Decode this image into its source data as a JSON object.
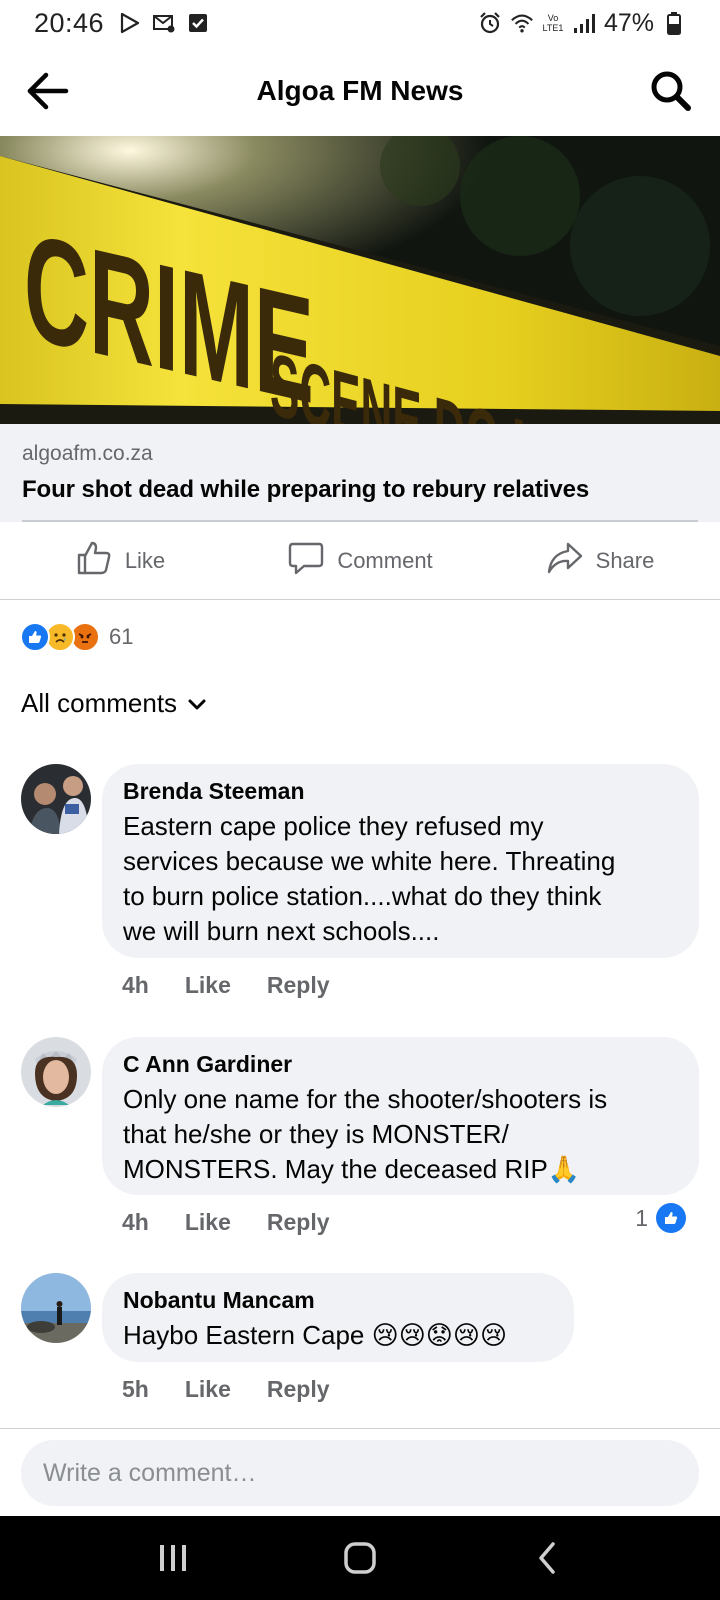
{
  "status_bar": {
    "time": "20:46",
    "carrier_label": "Vo LTE1",
    "battery_percent": "47%",
    "icons": [
      "play-store-icon",
      "mail-settings-icon",
      "checkbox-icon",
      "alarm-icon",
      "wifi-icon",
      "signal-icon",
      "battery-icon"
    ]
  },
  "header": {
    "title": "Algoa FM News",
    "icons": [
      "back-arrow-icon",
      "search-icon"
    ]
  },
  "post": {
    "image_text": "CRIME SCENE DO NOT CROSS",
    "link_domain": "algoafm.co.za",
    "link_title": "Four shot dead while preparing to rebury relatives"
  },
  "actions": {
    "like": "Like",
    "comment": "Comment",
    "share": "Share"
  },
  "reactions": {
    "count": "61",
    "types": [
      "like",
      "sad",
      "angry"
    ]
  },
  "comments_filter": {
    "label": "All comments"
  },
  "comments": [
    {
      "name": "Brenda Steeman",
      "lines": [
        "Eastern cape police they refused my",
        "services because we white here. Threating",
        "to burn police station....what do they think",
        "we will burn next schools...."
      ],
      "time": "4h",
      "like_label": "Like",
      "reply_label": "Reply"
    },
    {
      "name": "C Ann Gardiner",
      "lines": [
        "Only one name for the shooter/shooters is",
        "that he/she or they is MONSTER/",
        "MONSTERS. May the deceased RIP🙏"
      ],
      "time": "4h",
      "like_label": "Like",
      "reply_label": "Reply",
      "likes": "1"
    },
    {
      "name": "Nobantu Mancam",
      "lines": [
        "Haybo Eastern Cape 😢😢😟😢😢"
      ],
      "time": "5h",
      "like_label": "Like",
      "reply_label": "Reply"
    }
  ],
  "composer": {
    "placeholder": "Write a comment…"
  },
  "nav": {
    "icons": [
      "recents-icon",
      "home-icon",
      "back-icon"
    ]
  },
  "colors": {
    "accent": "#1877f2",
    "bubble": "#f0f2f5",
    "secondary_text": "#65676b"
  }
}
